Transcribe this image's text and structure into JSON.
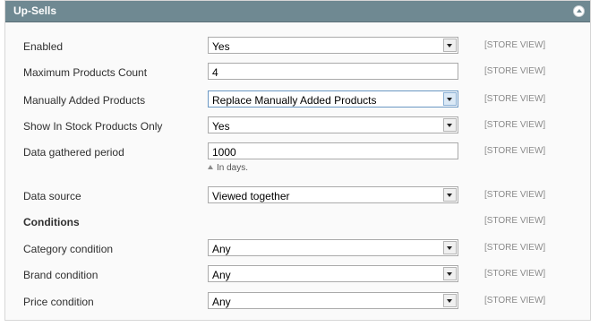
{
  "section": {
    "title": "Up-Sells",
    "collapse_icon": "collapse-arrow-icon"
  },
  "scope_label": "[STORE VIEW]",
  "fields": {
    "enabled": {
      "label": "Enabled",
      "value": "Yes"
    },
    "max_count": {
      "label": "Maximum Products Count",
      "value": "4"
    },
    "manual": {
      "label": "Manually Added Products",
      "value": "Replace Manually Added Products"
    },
    "in_stock": {
      "label": "Show In Stock Products Only",
      "value": "Yes"
    },
    "period": {
      "label": "Data gathered period",
      "value": "1000",
      "note": "In days."
    },
    "source": {
      "label": "Data source",
      "value": "Viewed together"
    },
    "conditions": {
      "label": "Conditions"
    },
    "category": {
      "label": "Category condition",
      "value": "Any"
    },
    "brand": {
      "label": "Brand condition",
      "value": "Any"
    },
    "price": {
      "label": "Price condition",
      "value": "Any"
    }
  }
}
